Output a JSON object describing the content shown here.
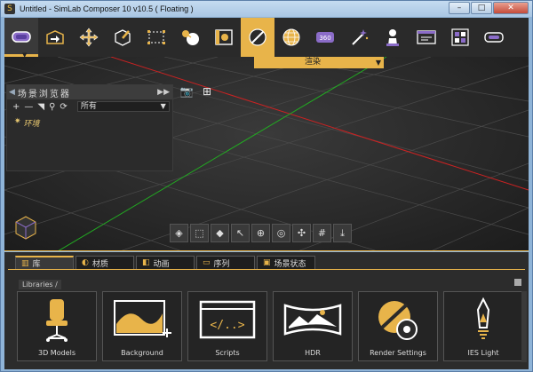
{
  "window": {
    "title": "Untitled - SimLab Composer 10 v10.5 ( Floating )",
    "minimize": "–",
    "maximize": "□",
    "close": "✕",
    "app_icon": "simlab-logo-icon"
  },
  "toolbar": {
    "tools": [
      {
        "icon": "vr-headset-icon"
      },
      {
        "icon": "open-box-icon"
      },
      {
        "icon": "move-arrows-icon"
      },
      {
        "icon": "box-edit-icon"
      },
      {
        "icon": "selection-frame-icon"
      },
      {
        "icon": "physics-icon"
      },
      {
        "icon": "animation-icon"
      },
      {
        "icon": "render-sphere-icon"
      },
      {
        "icon": "globe-grid-icon"
      },
      {
        "icon": "360-icon"
      },
      {
        "icon": "magic-wand-icon"
      },
      {
        "icon": "figure-icon"
      },
      {
        "icon": "presentation-icon"
      },
      {
        "icon": "grid-panels-icon"
      },
      {
        "icon": "vr-goggles-icon"
      }
    ],
    "mode_dropdown": "渲染",
    "dropdown_arrow": "▼"
  },
  "scene_browser": {
    "title": "场景浏览器",
    "collapse_left": "◀",
    "collapse_right": "▶▶",
    "add": "+",
    "remove": "—",
    "filter_value": "所有",
    "filter_arrow": "▼",
    "tree_item": "环境",
    "tree_star": "✷"
  },
  "viewport_tools": {
    "camera_icon": "camera-icon",
    "fit_icon": "fit-view-icon",
    "buttons": [
      "◈",
      "⬚",
      "◆",
      "↖",
      "⊕",
      "◎",
      "✣",
      "#",
      "⤓"
    ]
  },
  "bottom_tabs": [
    {
      "label": "库",
      "icon": "library-icon",
      "active": true
    },
    {
      "label": "材质",
      "icon": "material-icon",
      "active": false
    },
    {
      "label": "动画",
      "icon": "animation-tab-icon",
      "active": false
    },
    {
      "label": "序列",
      "icon": "sequence-icon",
      "active": false
    },
    {
      "label": "场景状态",
      "icon": "scene-state-icon",
      "active": false
    }
  ],
  "breadcrumb": "Libraries  /",
  "libraries": [
    {
      "label": "3D Models",
      "icon": "chair-icon"
    },
    {
      "label": "Background",
      "icon": "background-image-icon"
    },
    {
      "label": "Scripts",
      "icon": "script-code-icon"
    },
    {
      "label": "HDR",
      "icon": "hdr-panorama-icon"
    },
    {
      "label": "Render Settings",
      "icon": "render-settings-icon"
    },
    {
      "label": "IES Light",
      "icon": "ies-light-icon"
    }
  ],
  "colors": {
    "accent": "#e8b44a",
    "purple": "#8b6cc8",
    "x_axis": "#cc2222",
    "y_axis": "#22aa22"
  }
}
